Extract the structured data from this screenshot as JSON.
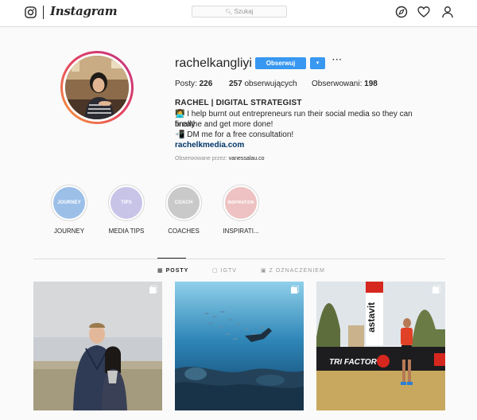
{
  "topbar": {
    "brand": "Instagram",
    "search_placeholder": "Szukaj"
  },
  "profile": {
    "username": "rachelkangliyi",
    "follow_label": "Obserwuj",
    "dropdown_glyph": "▾",
    "more_glyph": "···",
    "stats": {
      "posts_label": "Posty:",
      "posts_value": "226",
      "followers_value": "257",
      "followers_label": "obserwujących",
      "following_label": "Obserwowani:",
      "following_value": "198"
    },
    "bio": {
      "name": "RACHEL | DIGITAL STRATEGIST",
      "line1": "👩‍💻 I help burnt out entrepreneurs run their social media so they can finally",
      "line2": "breathe and get more done!",
      "line3": "📲 DM me for a free consultation!",
      "link": "rachelkmedia.com"
    },
    "followed_by_label": "Obserwowane przez:",
    "followed_by_user": "vanessalau.co"
  },
  "highlights": [
    {
      "cover": "JOURNEY",
      "label": "JOURNEY",
      "color": "#9cbfe8"
    },
    {
      "cover": "TIPS",
      "label": "MEDIA TIPS",
      "color": "#c7c4e8"
    },
    {
      "cover": "COACH",
      "label": "COACHES",
      "color": "#c9c9c9"
    },
    {
      "cover": "INSPIRATION",
      "label": "INSPIRATI...",
      "color": "#eec2c2"
    }
  ],
  "tabs": [
    {
      "label": "POSTY",
      "icon": "grid-icon",
      "active": true
    },
    {
      "label": "IGTV",
      "icon": "igtv-icon",
      "active": false
    },
    {
      "label": "Z OZNACZENIEM",
      "icon": "tagged-icon",
      "active": false
    }
  ],
  "posts": [
    {
      "alt": "couple-photo",
      "multi": true
    },
    {
      "alt": "underwater-diver",
      "multi": true
    },
    {
      "alt": "race-banner",
      "multi": true,
      "banner_text": "astavit",
      "sign_text": "TRI FACTOR"
    }
  ],
  "colors": {
    "accent": "#3897f0",
    "link": "#003569",
    "border": "#dbdbdb",
    "background": "#fafafa"
  }
}
